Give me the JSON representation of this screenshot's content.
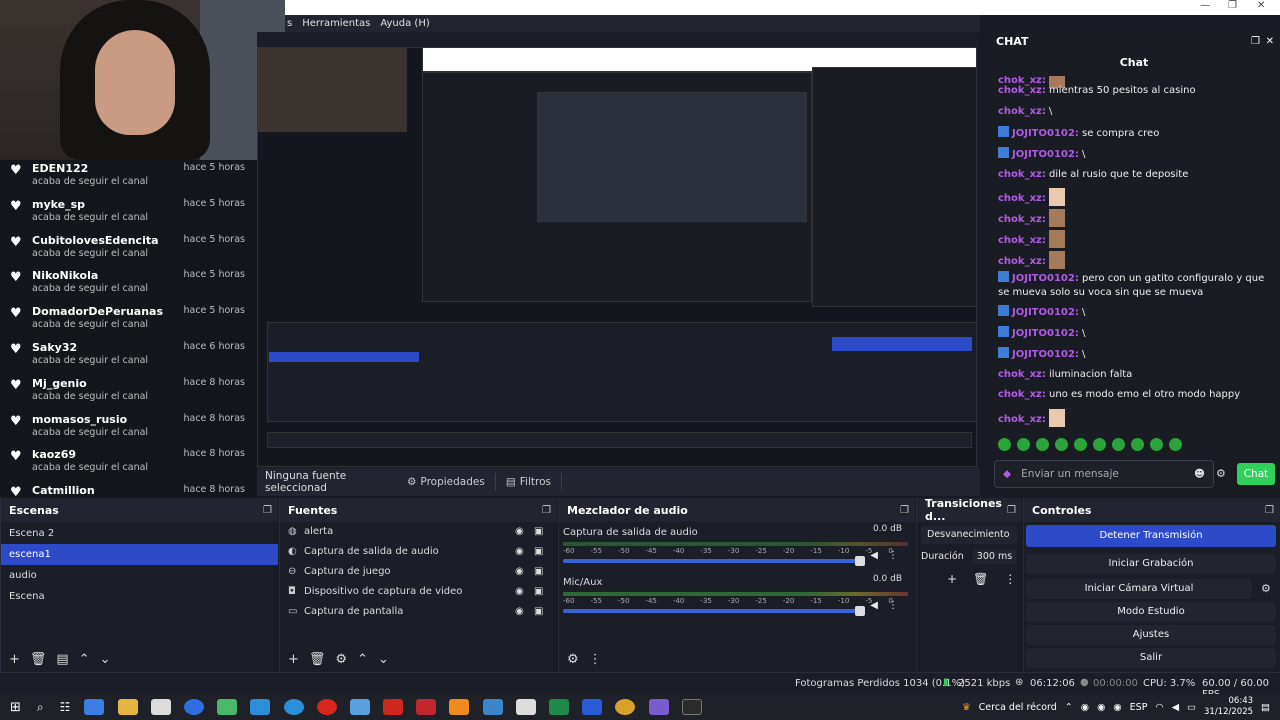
{
  "menubar": {
    "items": [
      "s",
      "Herramientas",
      "Ayuda (H)"
    ]
  },
  "follows": [
    {
      "name": "EDEN122",
      "status": "acaba de seguir el canal",
      "time": "hace 5 horas"
    },
    {
      "name": "myke_sp",
      "status": "acaba de seguir el canal",
      "time": "hace 5 horas"
    },
    {
      "name": "CubitolovesEdencita",
      "status": "acaba de seguir el canal",
      "time": "hace 5 horas"
    },
    {
      "name": "NikoNikola",
      "status": "acaba de seguir el canal",
      "time": "hace 5 horas"
    },
    {
      "name": "DomadorDePeruanas",
      "status": "acaba de seguir el canal",
      "time": "hace 5 horas"
    },
    {
      "name": "Saky32",
      "status": "acaba de seguir el canal",
      "time": "hace 6 horas"
    },
    {
      "name": "Mj_genio",
      "status": "acaba de seguir el canal",
      "time": "hace 8 horas"
    },
    {
      "name": "momasos_rusio",
      "status": "acaba de seguir el canal",
      "time": "hace 8 horas"
    },
    {
      "name": "kaoz69",
      "status": "acaba de seguir el canal",
      "time": "hace 8 horas"
    },
    {
      "name": "Catmillion",
      "status": "",
      "time": "hace 8 horas"
    }
  ],
  "propbar": {
    "selected": "Ninguna fuente seleccionad",
    "properties": "Propiedades",
    "filters": "Filtros"
  },
  "chat": {
    "header": "CHAT",
    "title": "Chat",
    "messages": [
      {
        "user": "chok_xz",
        "text": "",
        "badge": false,
        "emote": "face"
      },
      {
        "user": "chok_xz",
        "text": "mientras 50 pesitos al casino",
        "badge": false
      },
      {
        "user": "chok_xz",
        "text": "\\",
        "badge": false
      },
      {
        "user": "JOJITO0102",
        "text": "se compra creo",
        "badge": true
      },
      {
        "user": "JOJITO0102",
        "text": "\\",
        "badge": true
      },
      {
        "user": "chok_xz",
        "text": "dile al rusio que te deposite",
        "badge": false
      },
      {
        "user": "chok_xz",
        "text": "",
        "badge": false,
        "emote": "cat"
      },
      {
        "user": "chok_xz",
        "text": "",
        "badge": false,
        "emote": "face"
      },
      {
        "user": "chok_xz",
        "text": "",
        "badge": false,
        "emote": "face"
      },
      {
        "user": "chok_xz",
        "text": "",
        "badge": false,
        "emote": "face"
      },
      {
        "user": "JOJITO0102",
        "text": "pero con un gatito configuralo y que se mueva solo su voca sin que se mueva",
        "badge": true
      },
      {
        "user": "JOJITO0102",
        "text": "\\",
        "badge": true
      },
      {
        "user": "JOJITO0102",
        "text": "\\",
        "badge": true
      },
      {
        "user": "JOJITO0102",
        "text": "\\",
        "badge": true
      },
      {
        "user": "chok_xz",
        "text": "iluminacion falta",
        "badge": false
      },
      {
        "user": "chok_xz",
        "text": "uno es modo emo el otro modo happy",
        "badge": false
      },
      {
        "user": "chok_xz",
        "text": "",
        "badge": false,
        "emote": "cat"
      }
    ],
    "input_placeholder": "Enviar un mensaje",
    "send_label": "Chat"
  },
  "scenes": {
    "title": "Escenas",
    "items": [
      "Escena 2",
      "escena1",
      "audio",
      "Escena"
    ],
    "active_index": 1
  },
  "sources": {
    "title": "Fuentes",
    "items": [
      {
        "label": "alerta",
        "icon": "globe-icon"
      },
      {
        "label": "Captura de salida de audio",
        "icon": "speaker-icon"
      },
      {
        "label": "Captura de juego",
        "icon": "gamepad-icon"
      },
      {
        "label": "Dispositivo de captura de video",
        "icon": "camera-icon"
      },
      {
        "label": "Captura de pantalla",
        "icon": "monitor-icon"
      }
    ]
  },
  "mixer": {
    "title": "Mezclador de audio",
    "channels": [
      {
        "name": "Captura de salida de audio",
        "db": "0.0 dB",
        "level": 0.0
      },
      {
        "name": "Mic/Aux",
        "db": "0.0 dB",
        "level": 0.55
      }
    ],
    "ticks": [
      "-60",
      "-55",
      "-50",
      "-45",
      "-40",
      "-35",
      "-30",
      "-25",
      "-20",
      "-15",
      "-10",
      "-5",
      "0"
    ]
  },
  "transitions": {
    "title": "Transiciones d...",
    "selected": "Desvanecimiento",
    "duration_label": "Duración",
    "duration_value": "300 ms"
  },
  "controls": {
    "title": "Controles",
    "buttons": [
      "Detener Transmisión",
      "Iniciar Grabación",
      "Iniciar Cámara Virtual",
      "Modo Estudio",
      "Ajustes",
      "Salir"
    ]
  },
  "status": {
    "dropped": "Fotogramas Perdidos 1034 (0.1%)",
    "bitrate": "2521 kbps",
    "stream_time": "06:12:06",
    "rec_time": "00:00:00",
    "cpu": "CPU: 3.7%",
    "fps": "60.00 / 60.00 FPS"
  },
  "taskbar": {
    "tray_label": "Cerca del récord",
    "lang": "ESP",
    "time": "06:43",
    "date": "31/12/2025"
  },
  "colors": {
    "accent": "#2d4ac9",
    "chat_send": "#2fd15a",
    "username": "#b05ae8"
  }
}
